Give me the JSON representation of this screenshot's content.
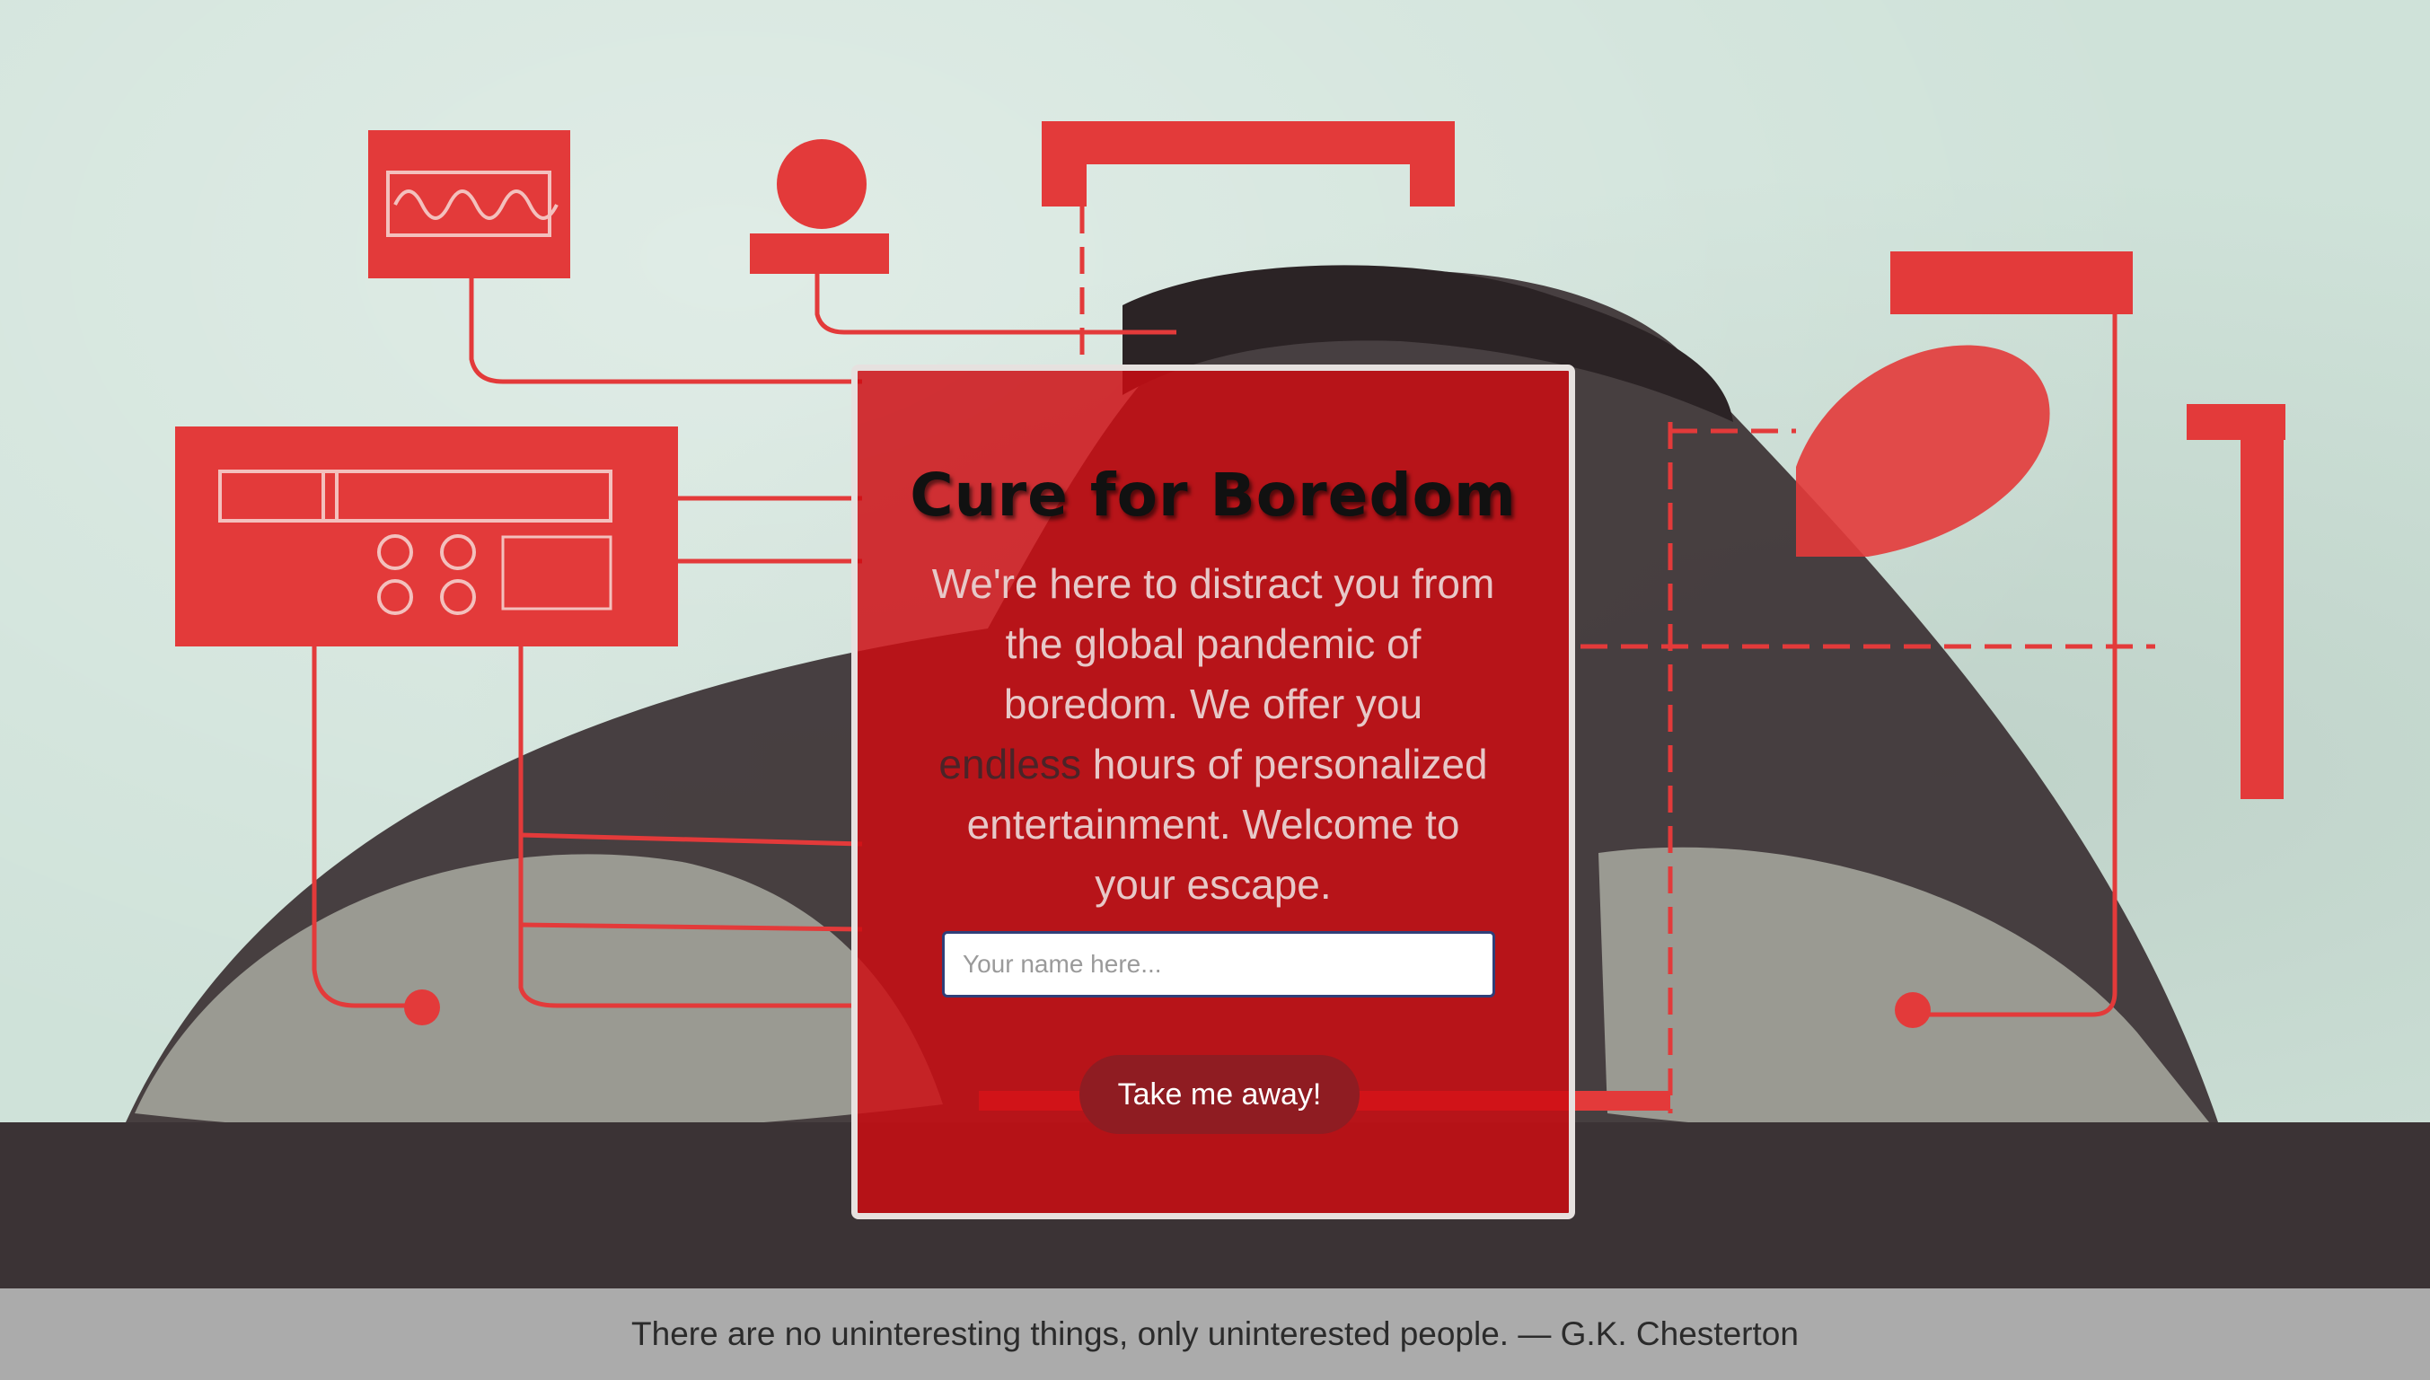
{
  "hero": {
    "title": "Cure for Boredom",
    "description_before": "We're here to distract you from the global pandemic of boredom. We offer you ",
    "description_emphasis": "endless",
    "description_after": " hours of personalized entertainment. Welcome to your escape."
  },
  "form": {
    "name_placeholder": "Your name here...",
    "name_value": "",
    "submit_label": "Take me away!"
  },
  "footer": {
    "quote": "There are no uninteresting things, only uninterested people. — G.K. Chesterton"
  },
  "colors": {
    "card_red": "#cd0c12",
    "button_red": "#8f1c22",
    "illustration_red": "#e33a3a",
    "background_mint": "#cfe2d9",
    "footer_gray": "#ababab"
  },
  "icons": {
    "background": "illustration-person-resting-with-machines"
  }
}
